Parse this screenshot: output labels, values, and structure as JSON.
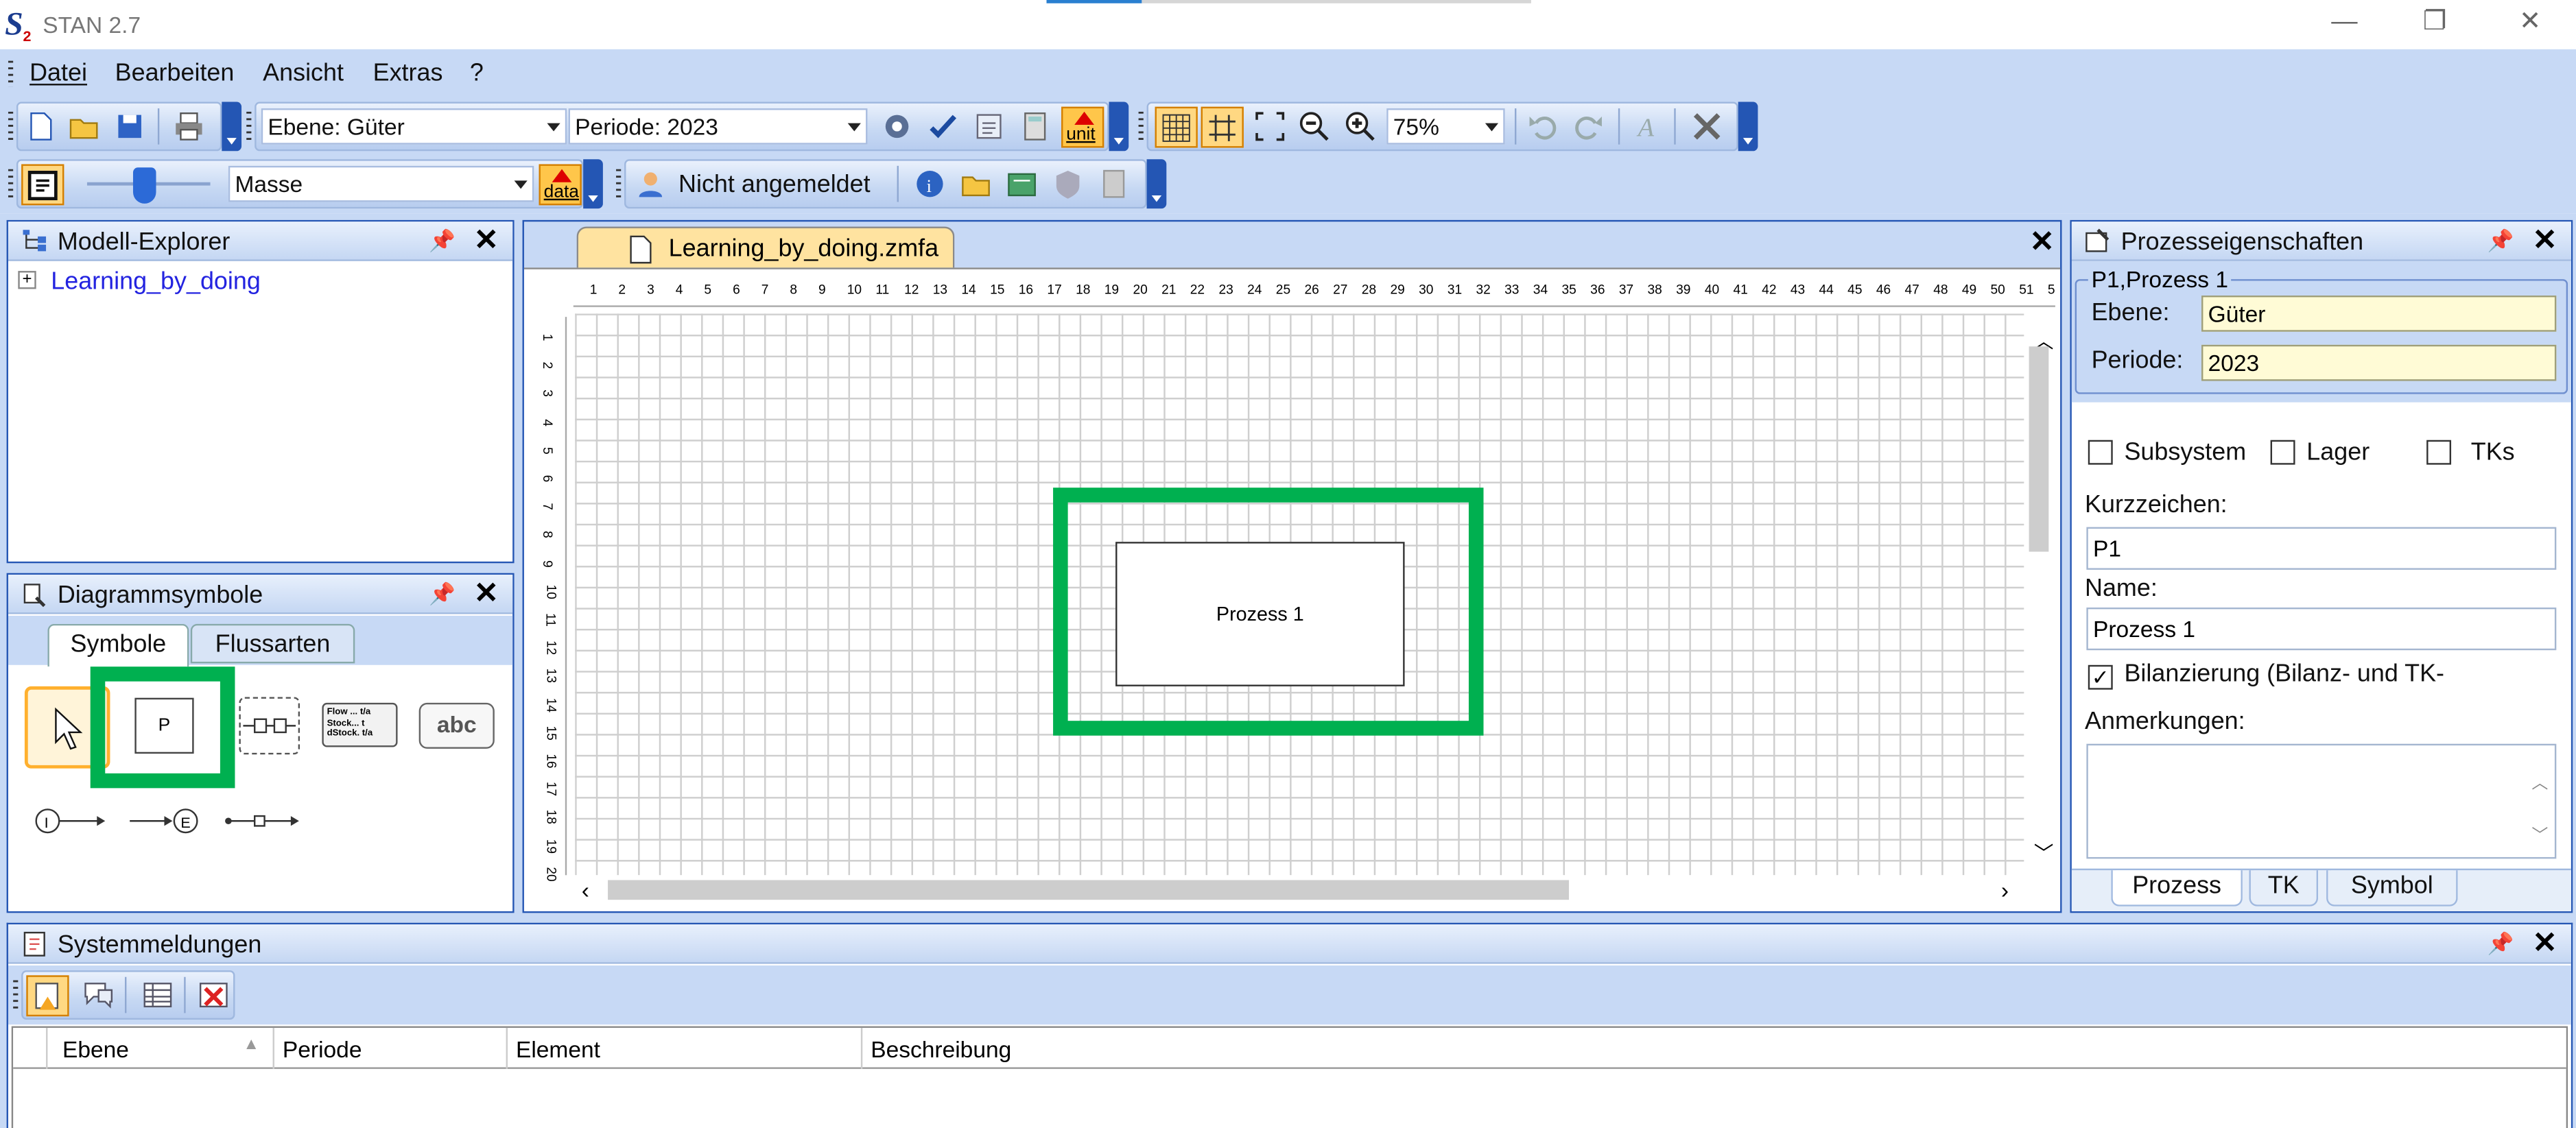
{
  "window": {
    "title": "STAN 2.7",
    "controls": [
      "—",
      "❐",
      "✕"
    ]
  },
  "menu": [
    "Datei",
    "Bearbeiten",
    "Ansicht",
    "Extras",
    "?"
  ],
  "toolbar1": {
    "ebene": "Ebene: Güter",
    "periode": "Periode: 2023",
    "zoom": "75%",
    "unit_label": "unit"
  },
  "toolbar2": {
    "layer": "Masse",
    "data_label": "data",
    "user": "Nicht angemeldet"
  },
  "explorer": {
    "title": "Modell-Explorer",
    "root": "Learning_by_doing",
    "expand": "+"
  },
  "symbols": {
    "title": "Diagrammsymbole",
    "tabs": [
      "Symbole",
      "Flussarten"
    ],
    "process_letter": "P",
    "text_symbol": "abc",
    "flow_lines": [
      "Flow ... t/a",
      "Stock... t",
      "dStock. t/a"
    ],
    "import_letter": "I",
    "export_letter": "E"
  },
  "document": {
    "tab": "Learning_by_doing.zmfa",
    "process_label": "Prozess 1",
    "ruler_h": [
      "1",
      "2",
      "3",
      "4",
      "5",
      "6",
      "7",
      "8",
      "9",
      "10",
      "11",
      "12",
      "13",
      "14",
      "15",
      "16",
      "17",
      "18",
      "19",
      "20",
      "21",
      "22",
      "23",
      "24",
      "25",
      "26",
      "27",
      "28",
      "29",
      "30",
      "31",
      "32",
      "33",
      "34",
      "35",
      "36",
      "37",
      "38",
      "39",
      "40",
      "41",
      "42",
      "43",
      "44",
      "45",
      "46",
      "47",
      "48",
      "49",
      "50",
      "51",
      "5"
    ],
    "ruler_v": [
      "1",
      "2",
      "3",
      "4",
      "5",
      "6",
      "7",
      "8",
      "9",
      "10",
      "11",
      "12",
      "13",
      "14",
      "15",
      "16",
      "17",
      "18",
      "19",
      "20"
    ]
  },
  "properties": {
    "title": "Prozesseigenschaften",
    "group": "P1,Prozess 1",
    "ebene_label": "Ebene:",
    "ebene_value": "Güter",
    "periode_label": "Periode:",
    "periode_value": "2023",
    "checks": [
      "Subsystem",
      "Lager",
      "TKs"
    ],
    "kurz_label": "Kurzzeichen:",
    "kurz_value": "P1",
    "name_label": "Name:",
    "name_value": "Prozess 1",
    "bilanz_label": "Bilanzierung (Bilanz- und TK-",
    "bilanz_checked": "✓",
    "anm_label": "Anmerkungen:",
    "tabs": [
      "Prozess",
      "TK",
      "Symbol"
    ]
  },
  "messages": {
    "title": "Systemmeldungen",
    "columns": [
      "Ebene",
      "Periode",
      "Element",
      "Beschreibung"
    ]
  },
  "colors": {
    "accent": "#2456b4",
    "highlight": "#00b050",
    "chrome": "#c7d9f5"
  }
}
